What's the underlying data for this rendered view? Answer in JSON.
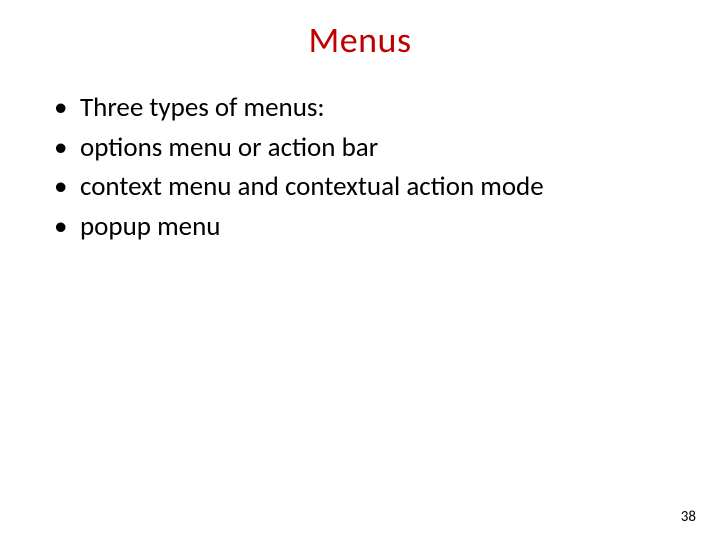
{
  "slide": {
    "title": "Menus",
    "bullets": [
      "Three types of menus:",
      "options menu or action bar",
      "context menu and contextual action mode",
      "popup menu"
    ],
    "pageNumber": "38"
  }
}
